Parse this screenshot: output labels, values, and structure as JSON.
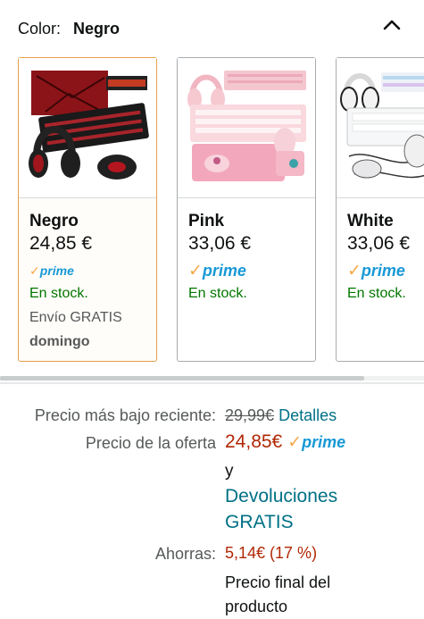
{
  "variation": {
    "label": "Color:",
    "selected_value": "Negro"
  },
  "swatches": [
    {
      "name": "Negro",
      "price": "24,85 €",
      "prime": "prime",
      "stock": "En stock.",
      "shipping": "Envío GRATIS",
      "delivery_day": "domingo",
      "selected": true
    },
    {
      "name": "Pink",
      "price": "33,06 €",
      "prime": "prime",
      "stock": "En stock."
    },
    {
      "name": "White",
      "price": "33,06 €",
      "prime": "prime",
      "stock": "En stock."
    }
  ],
  "price_block": {
    "recent_low_label": "Precio más bajo reciente:",
    "recent_low_price": "29,99€",
    "details_link": "Detalles",
    "offer_label": "Precio de la oferta",
    "offer_price": "24,85€",
    "prime": "prime",
    "and": "y",
    "returns_line1": "Devoluciones",
    "returns_line2": "GRATIS",
    "savings_label": "Ahorras:",
    "savings_value": "5,14€ (17 %)",
    "final_price_line1": "Precio final del",
    "final_price_line2": "producto"
  },
  "colors": {
    "selected_border": "#e3a04a",
    "in_stock": "#007600",
    "link": "#007185",
    "price_red": "#b12704",
    "prime_blue": "#1899d6",
    "prime_check": "#f3a847"
  },
  "icons": {
    "collapse": "chevron-up-icon",
    "prime_check": "check-icon"
  }
}
